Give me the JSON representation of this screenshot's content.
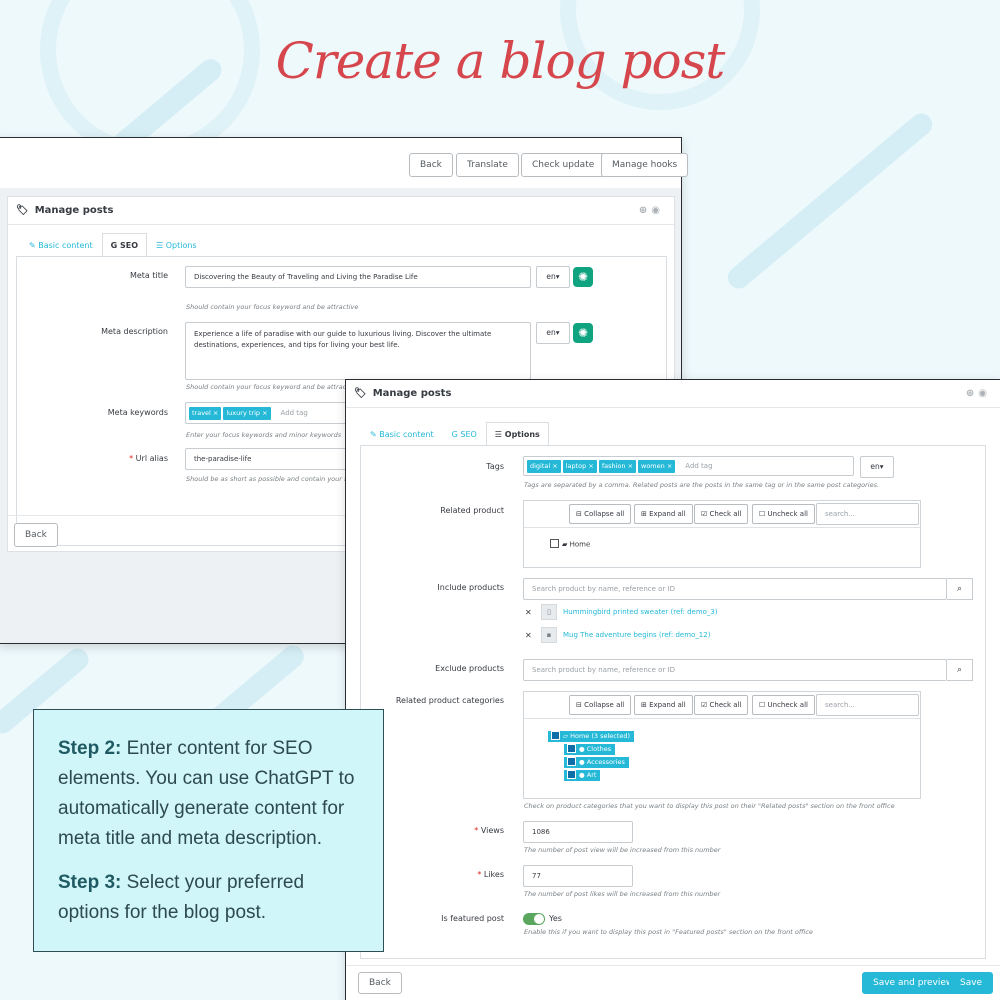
{
  "page": {
    "title": "Create a blog post"
  },
  "window1": {
    "toolbar": {
      "back": "Back",
      "translate": "Translate",
      "check_update": "Check update",
      "manage_hooks": "Manage hooks"
    },
    "panel_title": "Manage posts",
    "tabs": {
      "basic": "Basic content",
      "seo": "SEO",
      "options": "Options"
    },
    "meta_title": {
      "label": "Meta title",
      "value": "Discovering the Beauty of Traveling and Living the Paradise Life",
      "hint": "Should contain your focus keyword and be attractive",
      "lang": "en▾"
    },
    "meta_description": {
      "label": "Meta description",
      "value": "Experience a life of paradise with our guide to luxurious living. Discover the ultimate destinations, experiences, and tips for living your best life.",
      "hint": "Should contain your focus keyword and be attractive",
      "lang": "en▾"
    },
    "meta_keywords": {
      "label": "Meta keywords",
      "tags": [
        "travel",
        "luxury trip"
      ],
      "placeholder": "Add tag",
      "hint": "Enter your focus keywords and minor keywords"
    },
    "url_alias": {
      "label": "Url alias",
      "value": "the-paradise-life",
      "hint": "Should be as short as possible and contain your focu"
    },
    "footer_back": "Back"
  },
  "window2": {
    "panel_title": "Manage posts",
    "tabs": {
      "basic": "Basic content",
      "seo": "SEO",
      "options": "Options"
    },
    "tags": {
      "label": "Tags",
      "items": [
        "digital",
        "laptop",
        "fashion",
        "women"
      ],
      "placeholder": "Add tag",
      "lang": "en▾",
      "hint": "Tags are separated by a comma. Related posts are the posts in the same tag or in the same post categories."
    },
    "related_product": {
      "label": "Related product",
      "collapse": "Collapse all",
      "expand": "Expand all",
      "check": "Check all",
      "uncheck": "Uncheck all",
      "search": "search...",
      "node": "Home"
    },
    "include_products": {
      "label": "Include products",
      "placeholder": "Search product by name, reference or ID",
      "items": [
        "Hummingbird printed sweater (ref: demo_3)",
        "Mug The adventure begins (ref: demo_12)"
      ]
    },
    "exclude_products": {
      "label": "Exclude products",
      "placeholder": "Search product by name, reference or ID"
    },
    "related_categories": {
      "label": "Related product categories",
      "collapse": "Collapse all",
      "expand": "Expand all",
      "check": "Check all",
      "uncheck": "Uncheck all",
      "search": "search...",
      "root": "Home (3 selected)",
      "children": [
        "Clothes",
        "Accessories",
        "Art"
      ],
      "hint": "Check on product categories that you want to display this post on their \"Related posts\" section on the front office"
    },
    "views": {
      "label": "Views",
      "value": "1086",
      "hint": "The number of post view will be increased from this number"
    },
    "likes": {
      "label": "Likes",
      "value": "77",
      "hint": "The number of post likes will be increased from this number"
    },
    "featured": {
      "label": "Is featured post",
      "value": "Yes",
      "hint": "Enable this if you want to display this post in \"Featured posts\" section on the front office"
    },
    "footer": {
      "back": "Back",
      "save_preview": "Save and preview",
      "save": "Save"
    }
  },
  "callout": {
    "step2_title": "Step 2:",
    "step2_text": " Enter content for SEO elements. You can use ChatGPT to automatically generate content for meta title and meta description.",
    "step3_title": "Step 3:",
    "step3_text": " Select your preferred options for the blog post."
  },
  "colors": {
    "accent": "#25b9d7",
    "title": "#d6474d",
    "chatgpt": "#10a37f",
    "save": "#25b9d7"
  }
}
